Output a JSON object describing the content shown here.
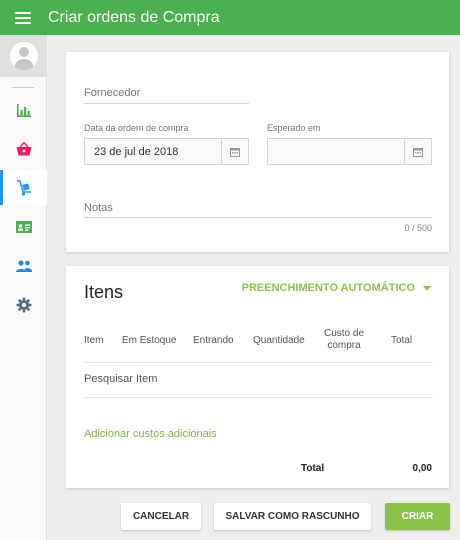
{
  "header": {
    "title": "Criar ordens de Compra"
  },
  "sidebar": {
    "items": [
      {
        "name": "reports",
        "icon": "bar-chart-icon",
        "color": "#4caf50"
      },
      {
        "name": "sales",
        "icon": "basket-icon",
        "color": "#e91e63"
      },
      {
        "name": "purchases",
        "icon": "hand-truck-icon",
        "color": "#2196f3",
        "active": true
      },
      {
        "name": "inventory",
        "icon": "id-card-icon",
        "color": "#4caf50"
      },
      {
        "name": "contacts",
        "icon": "people-icon",
        "color": "#1e88e5"
      },
      {
        "name": "settings",
        "icon": "gear-icon",
        "color": "#546e7a"
      }
    ]
  },
  "form": {
    "supplier_label": "Fornecedor",
    "order_date_label": "Data da ordem de compra",
    "order_date_value": "23 de jul de 2018",
    "expected_label": "Esperado em",
    "expected_value": "",
    "notes_label": "Notas",
    "notes_counter": "0 / 500"
  },
  "items": {
    "title": "Itens",
    "autofill_label": "PREENCHIMENTO AUTOMÁTICO",
    "columns": [
      "Item",
      "Em Estoque",
      "Entrando",
      "Quantidade",
      "Custo de compra",
      "Total"
    ],
    "search_placeholder": "Pesquisar Item",
    "add_costs_label": "Adicionar custos adicionais",
    "total_label": "Total",
    "total_value": "0,00"
  },
  "actions": {
    "cancel_label": "CANCELAR",
    "draft_label": "SALVAR COMO RASCUNHO",
    "create_label": "CRIAR"
  },
  "colors": {
    "appbar": "#4caf50",
    "accent": "#8bc34a",
    "active_indicator": "#2196f3"
  }
}
